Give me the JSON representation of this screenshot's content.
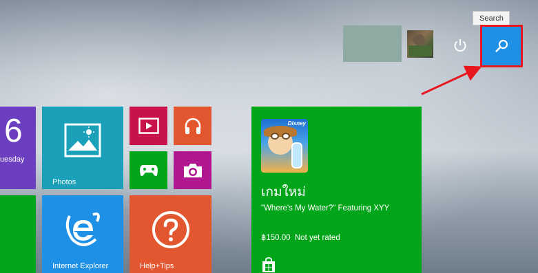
{
  "top_bar": {
    "search_tooltip": "Search"
  },
  "tiles": {
    "calendar": {
      "day_number": "6",
      "day_name": "uesday"
    },
    "photos": {
      "label": "Photos"
    },
    "internet_explorer": {
      "label": "Internet Explorer"
    },
    "help_tips": {
      "label": "Help+Tips"
    },
    "store": {
      "heading": "เกมใหม่",
      "title": "\"Where's My Water?\" Featuring XYY",
      "price_line": "฿150.00  Not yet rated",
      "app_badge": "Disney"
    }
  },
  "colors": {
    "search_button": "#1e90e6",
    "highlight_border": "#e8171f",
    "annotation_arrow": "#e8171f",
    "store_tile": "#00a51a",
    "photos_tile": "#1aa0b8",
    "ie_tile": "#1e90e6",
    "help_tile": "#e2572f",
    "calendar_tile": "#6b3fc0",
    "video_tile": "#c8124a",
    "music_tile": "#e2572f",
    "games_tile": "#00a51a",
    "camera_tile": "#b0168f"
  }
}
